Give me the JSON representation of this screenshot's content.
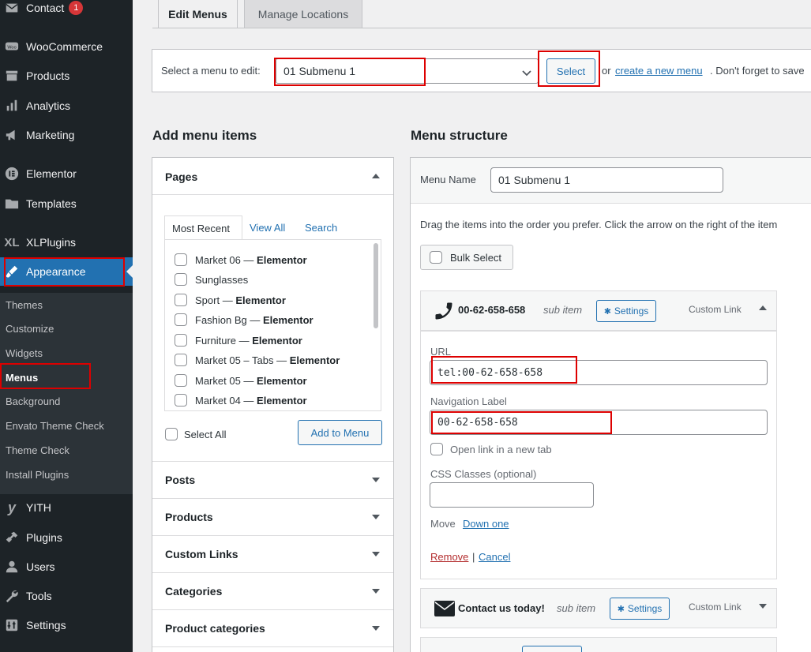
{
  "sidebar": {
    "items": [
      {
        "label": "Contact",
        "badge": "1",
        "icon": "envelope-icon"
      },
      {
        "label": "WooCommerce",
        "icon": "woo-icon"
      },
      {
        "label": "Products",
        "icon": "archive-icon"
      },
      {
        "label": "Analytics",
        "icon": "bar-chart-icon"
      },
      {
        "label": "Marketing",
        "icon": "megaphone-icon"
      },
      {
        "label": "Elementor",
        "icon": "elementor-icon"
      },
      {
        "label": "Templates",
        "icon": "folder-icon"
      },
      {
        "label": "XLPlugins",
        "icon": "xl-icon",
        "icon_text": "XL"
      },
      {
        "label": "Appearance",
        "icon": "paintbrush-icon"
      },
      {
        "label": "YITH",
        "icon": "yith-icon"
      },
      {
        "label": "Plugins",
        "icon": "plugin-icon"
      },
      {
        "label": "Users",
        "icon": "users-icon"
      },
      {
        "label": "Tools",
        "icon": "wrench-icon"
      },
      {
        "label": "Settings",
        "icon": "settings-icon"
      }
    ],
    "submenu": [
      "Themes",
      "Customize",
      "Widgets",
      "Menus",
      "Background",
      "Envato Theme Check",
      "Theme Check",
      "Install Plugins"
    ]
  },
  "tabs": {
    "edit": "Edit Menus",
    "manage": "Manage Locations"
  },
  "manage": {
    "prompt": "Select a menu to edit:",
    "selected_menu": "01 Submenu 1",
    "select_button": "Select",
    "or_text": "or",
    "create_link": "create a new menu",
    "after_text": ". Don't forget to save"
  },
  "add_items": {
    "heading": "Add menu items",
    "pages_title": "Pages",
    "inner_tabs": {
      "recent": "Most Recent",
      "all": "View All",
      "search": "Search"
    },
    "pages": [
      {
        "name": "Market 06",
        "suffix": "Elementor"
      },
      {
        "name": "Sunglasses",
        "suffix": ""
      },
      {
        "name": "Sport",
        "suffix": "Elementor"
      },
      {
        "name": "Fashion Bg",
        "suffix": "Elementor"
      },
      {
        "name": "Furniture",
        "suffix": "Elementor"
      },
      {
        "name": "Market 05 – Tabs",
        "suffix": "Elementor"
      },
      {
        "name": "Market 05",
        "suffix": "Elementor"
      },
      {
        "name": "Market 04",
        "suffix": "Elementor"
      }
    ],
    "dash": " — ",
    "select_all": "Select All",
    "add_button": "Add to Menu",
    "sections": [
      "Posts",
      "Products",
      "Custom Links",
      "Categories",
      "Product categories"
    ]
  },
  "structure": {
    "heading": "Menu structure",
    "menu_name_label": "Menu Name",
    "menu_name_value": "01 Submenu 1",
    "instructions": "Drag the items into the order you prefer. Click the arrow on the right of the item",
    "bulk_select": "Bulk Select",
    "items": [
      {
        "title": "00-62-658-658",
        "sub": "sub item",
        "settings": "Settings",
        "type": "Custom Link",
        "icon": "phone-icon",
        "url_label": "URL",
        "url_value": "tel:00-62-658-658",
        "nav_label": "Navigation Label",
        "nav_value": "00-62-658-658",
        "new_tab": "Open link in a new tab",
        "css_label": "CSS Classes (optional)",
        "move_label": "Move",
        "move_link": "Down one",
        "remove": "Remove",
        "sep": "|",
        "cancel": "Cancel"
      },
      {
        "title": "Contact us today!",
        "sub": "sub item",
        "settings": "Settings",
        "type": "Custom Link",
        "icon": "envelope-icon"
      }
    ]
  },
  "colors": {
    "accent": "#2271b1",
    "sidebar": "#1d2327",
    "highlight": "#dd0000"
  }
}
